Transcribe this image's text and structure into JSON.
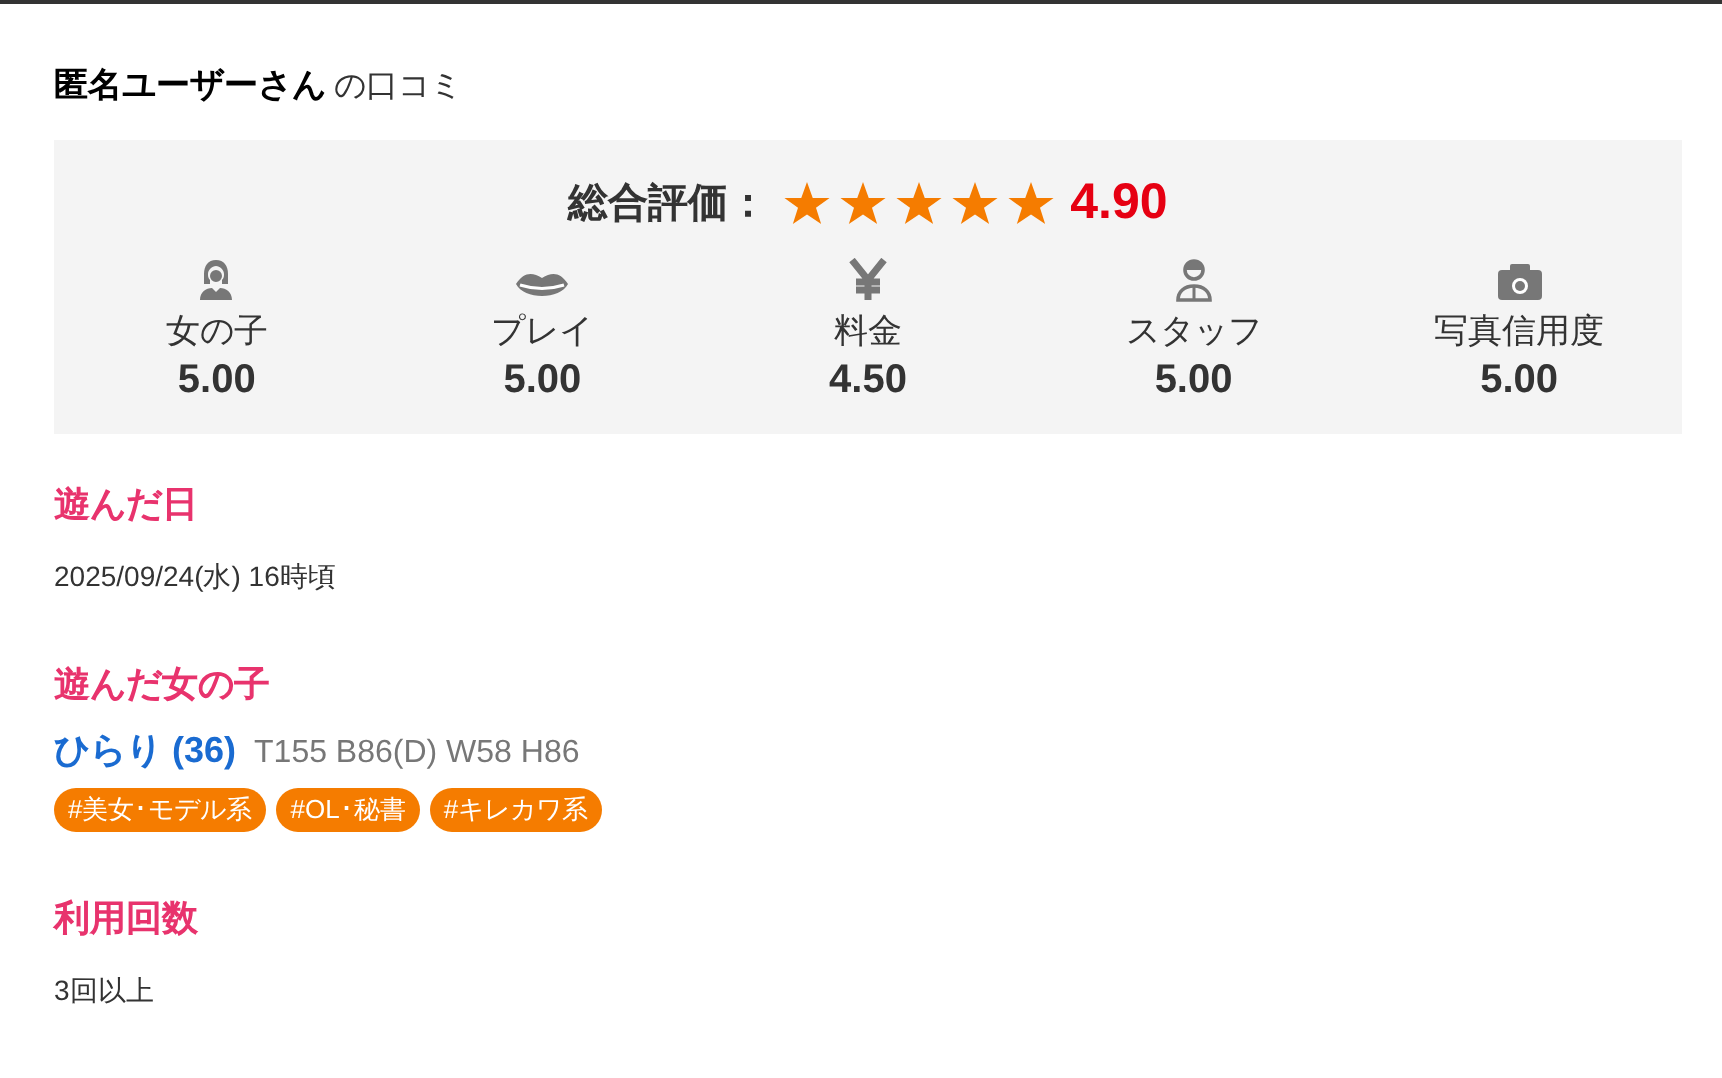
{
  "header": {
    "name": "匿名ユーザーさん",
    "suffix": "の口コミ"
  },
  "overall": {
    "label": "総合評価：",
    "stars": 5,
    "score": "4.90"
  },
  "categories": [
    {
      "kind": "girl",
      "label": "女の子",
      "score": "5.00"
    },
    {
      "kind": "play",
      "label": "プレイ",
      "score": "5.00"
    },
    {
      "kind": "price",
      "label": "料金",
      "score": "4.50"
    },
    {
      "kind": "staff",
      "label": "スタッフ",
      "score": "5.00"
    },
    {
      "kind": "photo",
      "label": "写真信用度",
      "score": "5.00"
    }
  ],
  "sections": [
    {
      "kind": "text",
      "title": "遊んだ日",
      "text": "2025/09/24(水) 16時頃"
    },
    {
      "kind": "girl",
      "title": "遊んだ女の子",
      "name": "ひらり (36)",
      "size": "T155 B86(D) W58 H86",
      "tags": [
        "#美女･モデル系",
        "#OL･秘書",
        "#キレカワ系"
      ]
    },
    {
      "kind": "text",
      "title": "利用回数",
      "text": "3回以上"
    }
  ]
}
